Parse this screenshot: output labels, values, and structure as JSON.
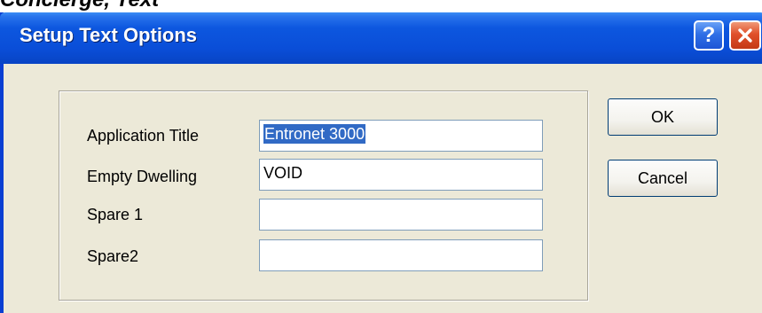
{
  "heading": "Concierge, Text",
  "window": {
    "title": "Setup Text Options",
    "help_label": "?",
    "close_icon": "close-icon"
  },
  "fields": [
    {
      "label": "Application Title",
      "value": "Entronet 3000",
      "selected": true
    },
    {
      "label": "Empty Dwelling",
      "value": "VOID"
    },
    {
      "label": "Spare 1",
      "value": ""
    },
    {
      "label": "Spare2",
      "value": ""
    }
  ],
  "buttons": {
    "ok_label": "OK",
    "cancel_label": "Cancel"
  },
  "colors": {
    "titlebar": "#0a4ed8",
    "dialog_bg": "#ece9d8",
    "close_button": "#e0502a",
    "selection": "#316ac5"
  }
}
